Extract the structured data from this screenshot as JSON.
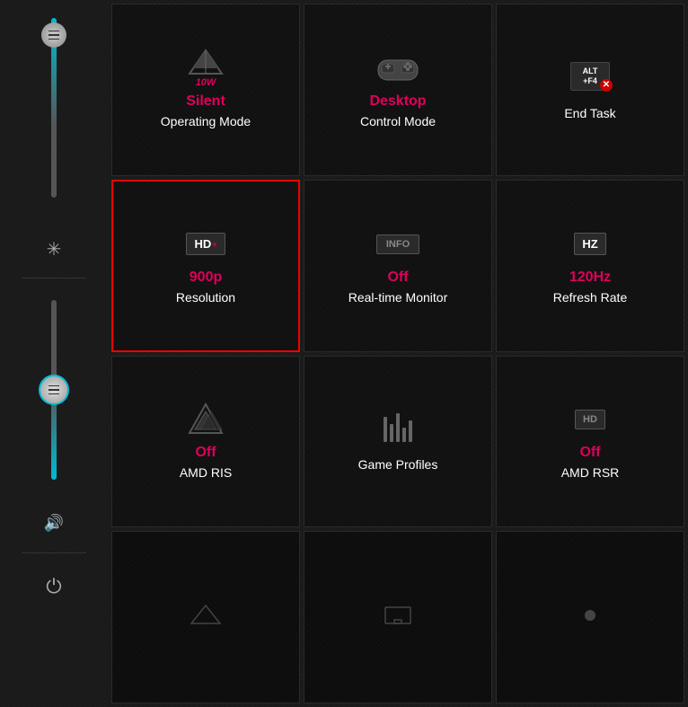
{
  "sidebar": {
    "slider1": {
      "label": "brightness-slider"
    },
    "brightness_icon": "☀",
    "slider2": {
      "label": "volume-slider"
    },
    "volume_icon": "🔊",
    "power_icon": "⏻"
  },
  "tiles": [
    {
      "id": "operating-mode",
      "value": "Silent",
      "label": "Operating Mode",
      "icon_type": "gigabyte-logo",
      "selected": false
    },
    {
      "id": "control-mode",
      "value": "Desktop",
      "label": "Control Mode",
      "icon_type": "gamepad",
      "selected": false
    },
    {
      "id": "end-task",
      "value": "",
      "label": "End Task",
      "icon_type": "altf4",
      "selected": false
    },
    {
      "id": "resolution",
      "value": "900p",
      "label": "Resolution",
      "icon_type": "hd-plus",
      "selected": true
    },
    {
      "id": "realtime-monitor",
      "value": "Off",
      "label": "Real-time Monitor",
      "icon_type": "info",
      "selected": false
    },
    {
      "id": "refresh-rate",
      "value": "120Hz",
      "label": "Refresh Rate",
      "icon_type": "hz",
      "selected": false
    },
    {
      "id": "amd-ris",
      "value": "Off",
      "label": "AMD RIS",
      "icon_type": "triangle",
      "selected": false
    },
    {
      "id": "game-profiles",
      "value": "",
      "label": "Game Profiles",
      "icon_type": "sliders",
      "selected": false
    },
    {
      "id": "amd-rsr",
      "value": "Off",
      "label": "AMD RSR",
      "icon_type": "hd-small",
      "selected": false
    },
    {
      "id": "bottom-1",
      "value": "",
      "label": "",
      "icon_type": "empty",
      "selected": false
    },
    {
      "id": "bottom-2",
      "value": "",
      "label": "",
      "icon_type": "empty2",
      "selected": false
    },
    {
      "id": "bottom-3",
      "value": "",
      "label": "",
      "icon_type": "dot",
      "selected": false
    }
  ]
}
